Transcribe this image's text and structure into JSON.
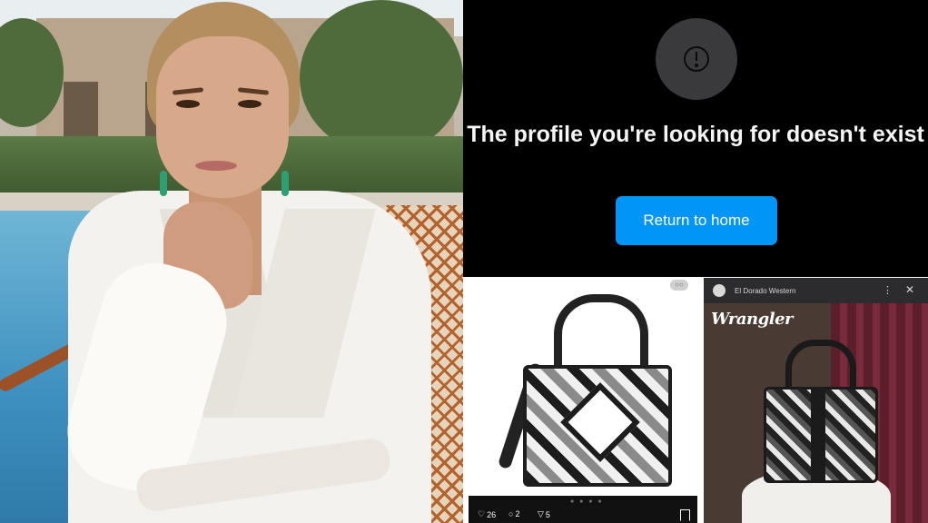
{
  "error_screen": {
    "title": "The profile you're looking for doesn't exist",
    "button_label": "Return to home"
  },
  "post": {
    "tag": "○○",
    "pager": "● ● ● ●",
    "likes": "26",
    "comments": "2",
    "shares": "5"
  },
  "ad": {
    "advertiser": "El Dorado Western",
    "brand": "Wrangler",
    "more_icon": "⋮",
    "close_icon": "✕"
  },
  "colors": {
    "error_bg": "#000000",
    "button_blue": "#0095f6",
    "ad_header": "#2c2c2e"
  }
}
